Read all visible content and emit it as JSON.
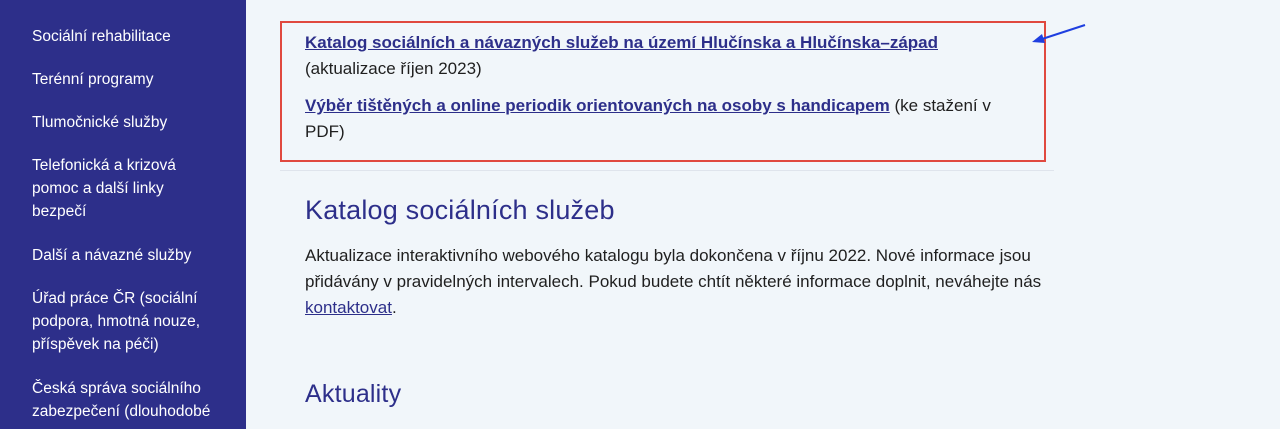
{
  "sidebar": {
    "items": [
      {
        "label": "Sociální rehabilitace"
      },
      {
        "label": "Terénní programy"
      },
      {
        "label": "Tlumočnické služby"
      },
      {
        "label": "Telefonická a krizová pomoc a další linky bezpečí"
      },
      {
        "label": "Další a návazné služby"
      },
      {
        "label": "Úřad práce ČR (sociální podpora, hmotná nouze, příspěvek na péči)"
      },
      {
        "label": "Česká správa sociálního zabezpečení (dlouhodobé"
      }
    ]
  },
  "callout": {
    "link1": {
      "text": "Katalog sociálních a návazných služeb na území Hlučínska a Hlučínska–západ",
      "note": " (aktualizace říjen 2023)"
    },
    "link2": {
      "text": "Výběr tištěných a online periodik orientovaných na osoby s handicapem",
      "note": " (ke stažení v PDF)"
    }
  },
  "catalog": {
    "heading": "Katalog sociálních služeb",
    "text_before": "Aktualizace interaktivního webového katalogu byla dokončena v říjnu 2022. Nové informace jsou přidávány v pravidelných intervalech. Pokud budete chtít některé informace doplnit, neváhejte nás ",
    "link": "kontaktovat",
    "text_after": "."
  },
  "news": {
    "heading": "Aktuality"
  },
  "colors": {
    "sidebar": "#2d2f8a",
    "accent": "#2d2f8a",
    "callout_border": "#e0493f",
    "arrow": "#1f3fe0"
  }
}
